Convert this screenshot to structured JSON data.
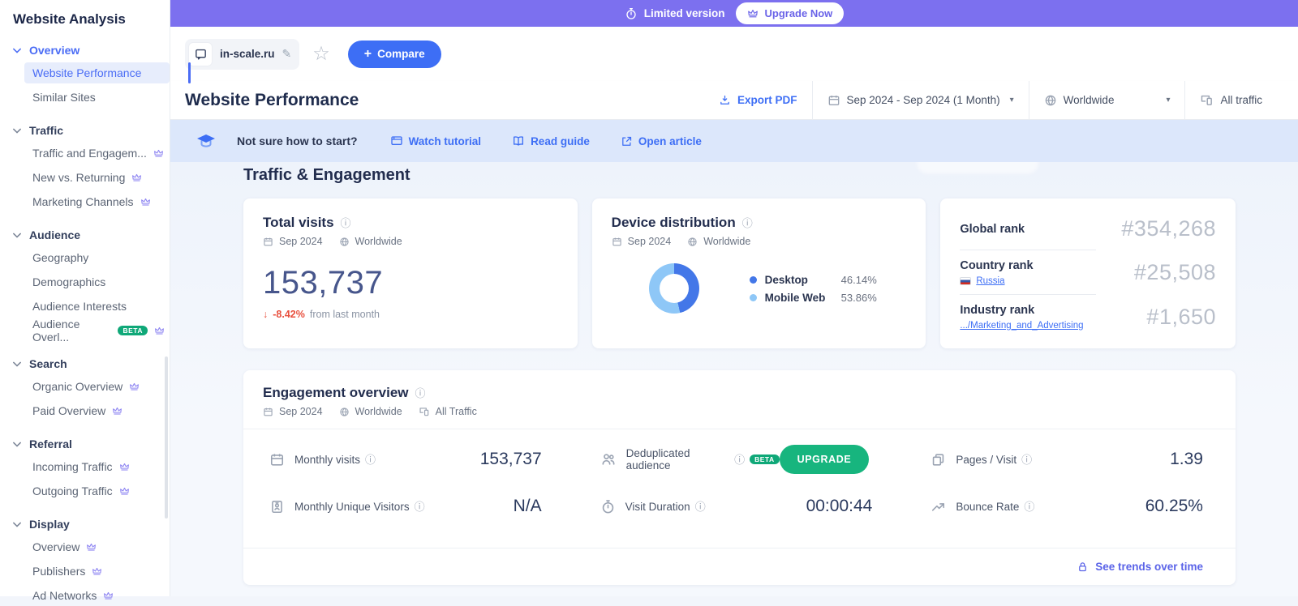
{
  "app": {
    "title": "Website Analysis"
  },
  "icons": {
    "caret_down": "▾",
    "star": "☆",
    "pencil": "✎",
    "down_arrow": "↓",
    "info": "ⓘ",
    "plus": "+"
  },
  "colors": {
    "brand_purple": "#7c70ef",
    "link_blue": "#3d6ef5",
    "upgrade_green": "#17b57e",
    "beta_green": "#0fa878",
    "negative_red": "#e8503e",
    "desktop_blue": "#4377e8",
    "mobile_blue": "#8ec7f7"
  },
  "topbar": {
    "limited_label": "Limited version",
    "upgrade_label": "Upgrade Now"
  },
  "domain_bar": {
    "domain": "in-scale.ru",
    "compare_label": "Compare"
  },
  "page_header": {
    "title": "Website Performance",
    "export_label": "Export PDF",
    "date_range": "Sep 2024 - Sep 2024 (1 Month)",
    "region": "Worldwide",
    "traffic_filter": "All traffic"
  },
  "onboarding_banner": {
    "question": "Not sure how to start?",
    "links": [
      {
        "label": "Watch tutorial"
      },
      {
        "label": "Read guide"
      },
      {
        "label": "Open article"
      }
    ]
  },
  "sidebar": {
    "sections": [
      {
        "label": "Overview",
        "items": [
          {
            "label": "Website Performance"
          },
          {
            "label": "Similar Sites"
          }
        ]
      },
      {
        "label": "Traffic",
        "items": [
          {
            "label": "Traffic and Engagem..."
          },
          {
            "label": "New vs. Returning"
          },
          {
            "label": "Marketing Channels"
          }
        ]
      },
      {
        "label": "Audience",
        "items": [
          {
            "label": "Geography"
          },
          {
            "label": "Demographics"
          },
          {
            "label": "Audience Interests"
          },
          {
            "label": "Audience Overl...",
            "beta": "BETA"
          }
        ]
      },
      {
        "label": "Search",
        "items": [
          {
            "label": "Organic Overview"
          },
          {
            "label": "Paid Overview"
          }
        ]
      },
      {
        "label": "Referral",
        "items": [
          {
            "label": "Incoming Traffic"
          },
          {
            "label": "Outgoing Traffic"
          }
        ]
      },
      {
        "label": "Display",
        "items": [
          {
            "label": "Overview"
          },
          {
            "label": "Publishers"
          },
          {
            "label": "Ad Networks"
          }
        ]
      }
    ]
  },
  "section": {
    "title": "Traffic & Engagement"
  },
  "total_visits": {
    "title": "Total visits",
    "date": "Sep 2024",
    "region": "Worldwide",
    "value": "153,737",
    "change": "-8.42%",
    "change_note": "from last month"
  },
  "device_distribution": {
    "title": "Device distribution",
    "date": "Sep 2024",
    "region": "Worldwide",
    "legend": [
      {
        "label": "Desktop",
        "value": "46.14%"
      },
      {
        "label": "Mobile Web",
        "value": "53.86%"
      }
    ]
  },
  "rank": {
    "rows": [
      {
        "label": "Global rank",
        "value": "#354,268"
      },
      {
        "label": "Country rank",
        "link": "Russia",
        "value": "#25,508"
      },
      {
        "label": "Industry rank",
        "link": ".../Marketing_and_Advertising",
        "value": "#1,650"
      }
    ]
  },
  "engagement": {
    "title": "Engagement overview",
    "date": "Sep 2024",
    "region": "Worldwide",
    "traffic": "All Traffic",
    "metrics": [
      {
        "label": "Monthly visits",
        "value": "153,737"
      },
      {
        "label": "Deduplicated audience",
        "badge": "BETA",
        "button": "UPGRADE"
      },
      {
        "label": "Pages / Visit",
        "value": "1.39"
      },
      {
        "label": "Monthly Unique Visitors",
        "value": "N/A"
      },
      {
        "label": "Visit Duration",
        "value": "00:00:44"
      },
      {
        "label": "Bounce Rate",
        "value": "60.25%"
      }
    ],
    "footer_link": "See trends over time"
  },
  "chart_data": {
    "type": "pie",
    "title": "Device distribution",
    "categories": [
      "Desktop",
      "Mobile Web"
    ],
    "values": [
      46.14,
      53.86
    ],
    "colors": [
      "#4377e8",
      "#8ec7f7"
    ],
    "legend_position": "right",
    "donut": true
  }
}
